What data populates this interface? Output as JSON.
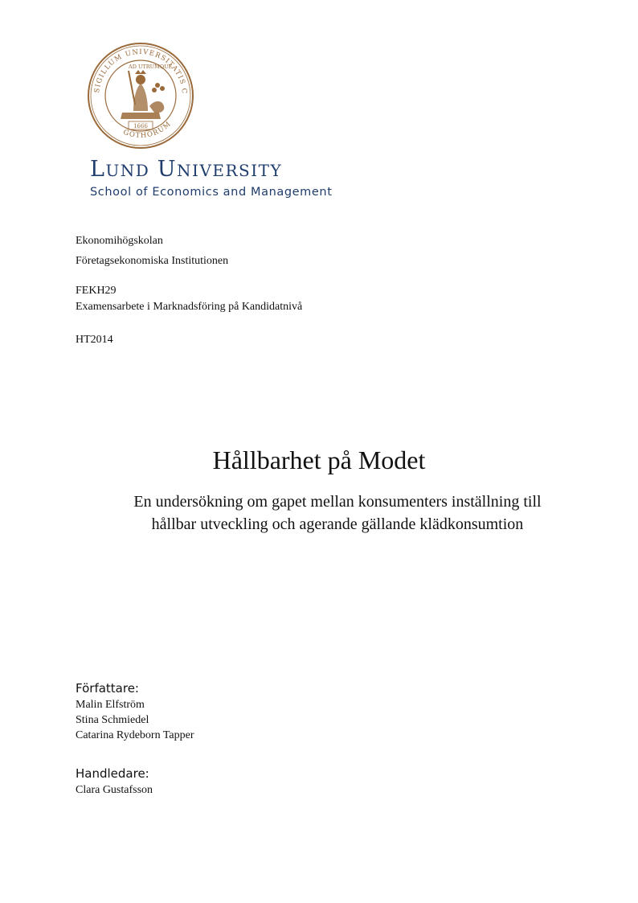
{
  "logo": {
    "seal_text_top": "SIGILLUM UNIVERSITATIS CAROLINAE",
    "seal_text_bottom": "GOTHORUM",
    "seal_motto": "AD UTRUMQUE",
    "seal_year": "1666",
    "university_name_initial_1": "L",
    "university_name_rest_1": "UND",
    "university_name_initial_2": "U",
    "university_name_rest_2": "NIVERSITY",
    "school": "School of Economics and Management",
    "color": "#1f3d6d",
    "seal_color": "#9b6a3a"
  },
  "institution": {
    "line1": "Ekonomihögskolan",
    "line2": "Företagsekonomiska Institutionen"
  },
  "course": {
    "code": "FEKH29",
    "name": "Examensarbete i Marknadsföring på Kandidatnivå"
  },
  "term": "HT2014",
  "title": "Hållbarhet på Modet",
  "subtitle": {
    "line1": "En undersökning om gapet mellan konsumenters inställning till",
    "line2": "hållbar utveckling och agerande gällande klädkonsumtion"
  },
  "authors": {
    "label": "Författare:",
    "names": [
      "Malin Elfström",
      "Stina Schmiedel",
      "Catarina Rydeborn Tapper"
    ]
  },
  "supervisor": {
    "label": "Handledare:",
    "name": "Clara Gustafsson"
  }
}
